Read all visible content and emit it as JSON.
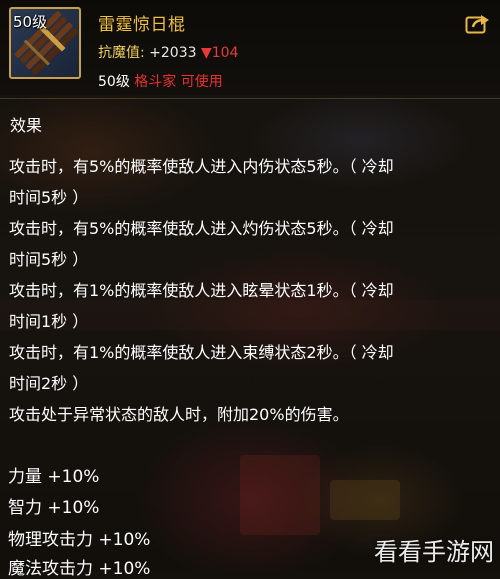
{
  "item": {
    "level_badge": "50级",
    "name": "雷霆惊日棍",
    "stat_label": "抗魔值:",
    "stat_value": "+2033",
    "stat_delta": "▼104",
    "req_level": "50级",
    "req_class": "格斗家 可使用"
  },
  "icons": {
    "item": "staff-bundle-icon",
    "share": "share-export-icon"
  },
  "colors": {
    "item_name": "#f0c040",
    "stat_label": "#f0d060",
    "decrease": "#e83a3a",
    "class_req": "#e83030",
    "slot_border": "#c9a048"
  },
  "effects": {
    "title": "效果",
    "lines": [
      "攻击时，有5%的概率使敌人进入内伤状态5秒。（ 冷却",
      "时间5秒 ）",
      "攻击时，有5%的概率使敌人进入灼伤状态5秒。（ 冷却",
      "时间5秒 ）",
      "攻击时，有1%的概率使敌人进入眩晕状态1秒。（ 冷却",
      "时间1秒 ）",
      "攻击时，有1%的概率使敌人进入束缚状态2秒。（ 冷却",
      "时间2秒 ）",
      "攻击处于异常状态的敌人时，附加20%的伤害。"
    ]
  },
  "bonuses": [
    "力量 +10%",
    "智力 +10%",
    "物理攻击力 +10%",
    "魔法攻击力 +10%"
  ],
  "watermark": "看看手游网"
}
